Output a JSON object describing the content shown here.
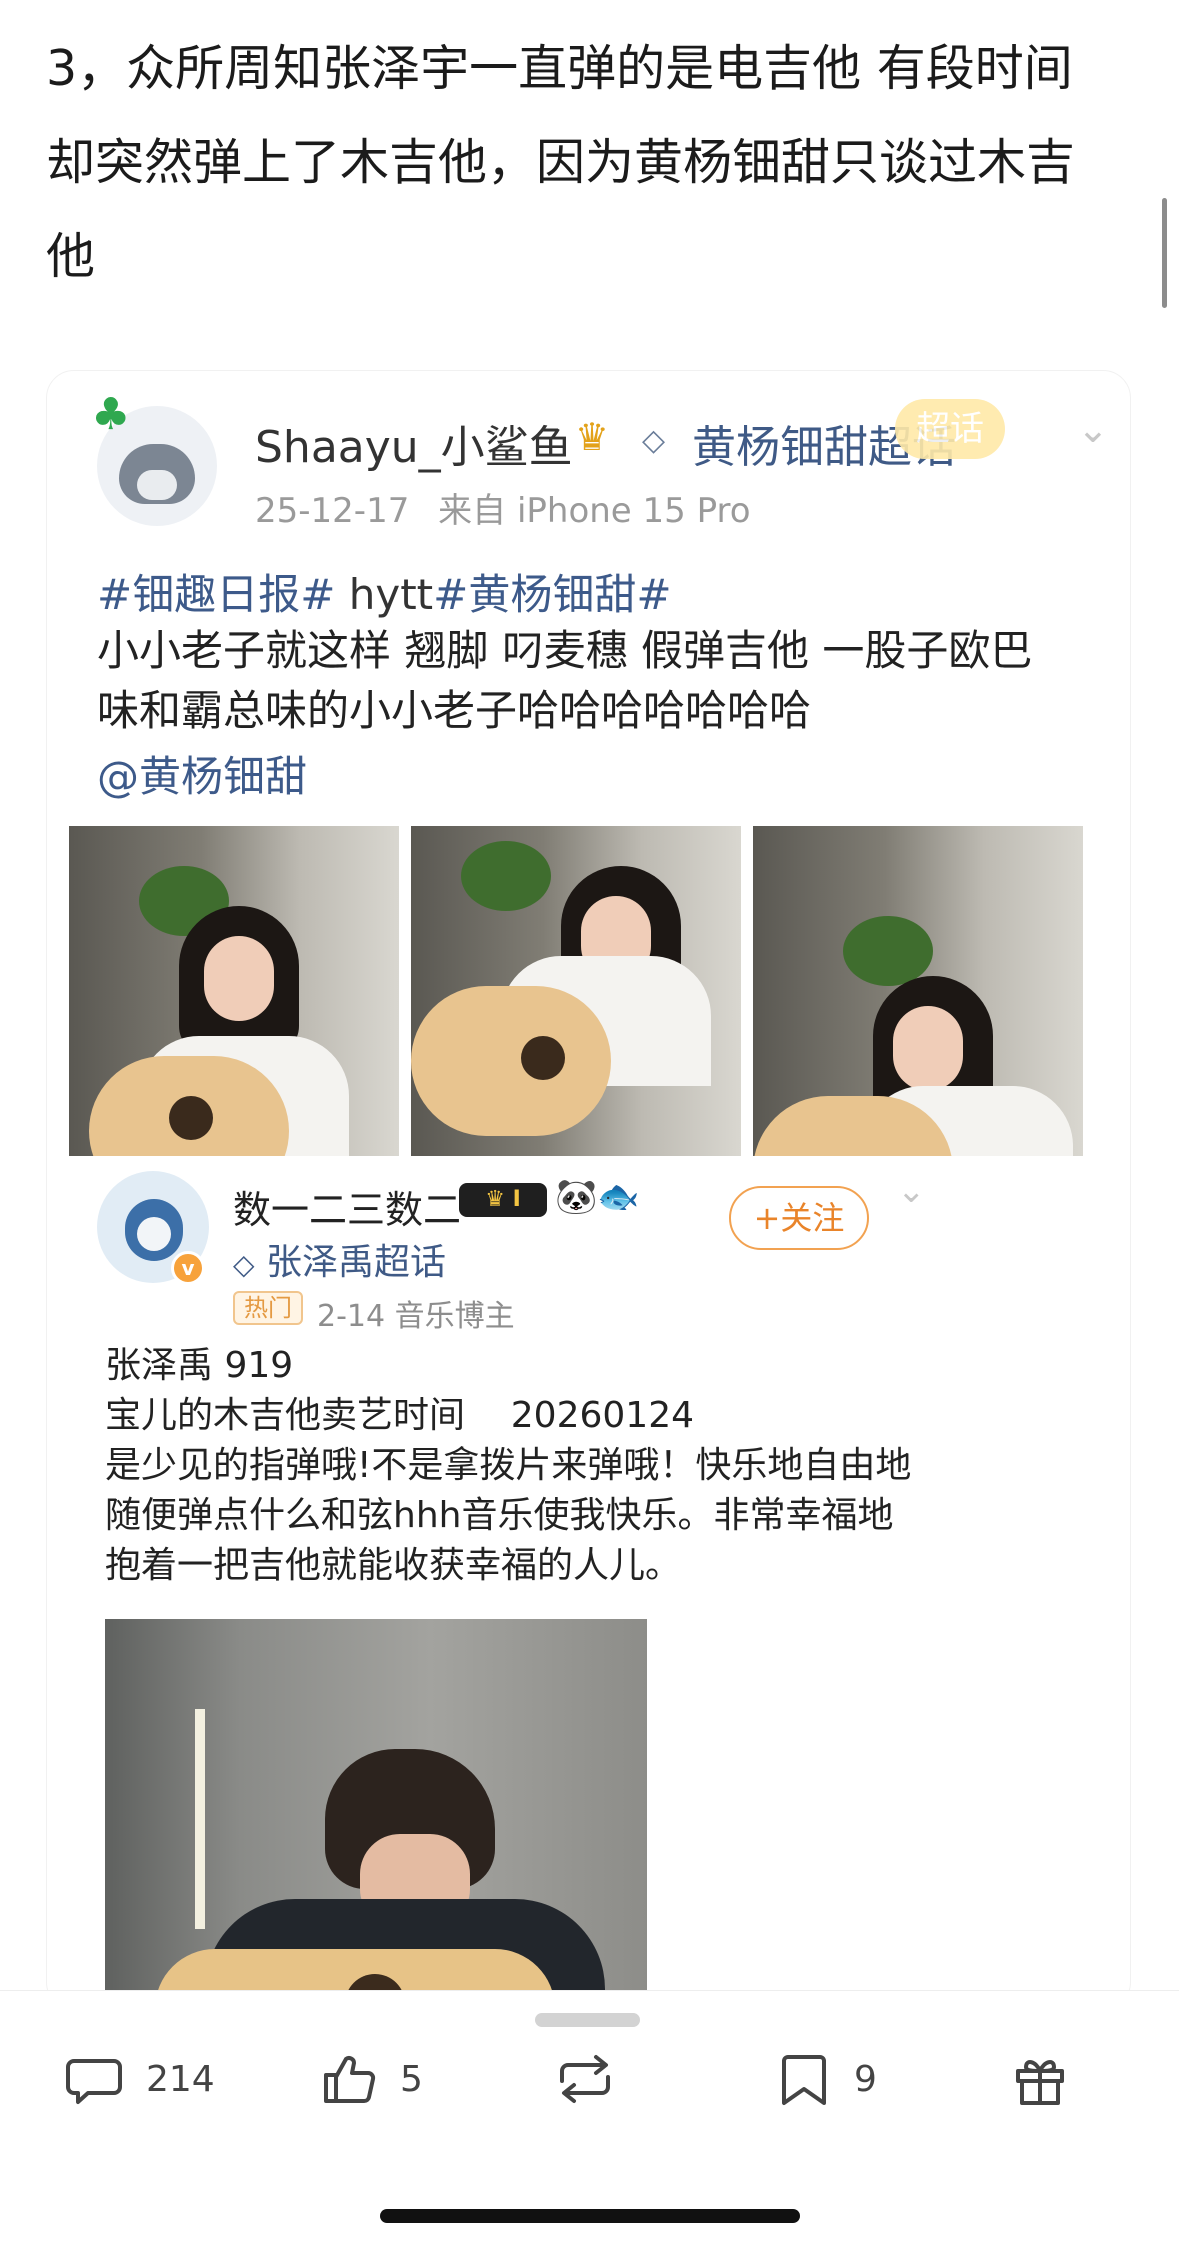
{
  "article": {
    "lines": [
      "3，众所周知张泽宇一直弹的是电吉他 有段时间",
      "却突然弹上了木吉他，因为黄杨钿甜只谈过木吉",
      "他"
    ]
  },
  "post1": {
    "username": "Shaayu_小鲨鱼",
    "topic": "黄杨钿甜超话",
    "badge": "超话",
    "date": "25-12-17",
    "source": "来自 iPhone 15 Pro",
    "tags": {
      "tag1": "#钿趣日报#",
      "plain": " hytt",
      "tag2": "#黄杨钿甜#"
    },
    "body_lines": [
      "小小老子就这样 翘脚 叼麦穗 假弹吉他 一股子欧巴",
      "味和霸总味的小小老子哈哈哈哈哈哈哈"
    ],
    "mention": "@黄杨钿甜"
  },
  "post2": {
    "username": "数一二三数二",
    "vip": "I",
    "topic": "张泽禹超话",
    "follow": "+关注",
    "hot": "热门",
    "meta": "2-14  音乐博主",
    "body_lines": [
      "张泽禹 919",
      "宝儿的木吉他卖艺时间    20260124",
      "是少见的指弹哦!不是拿拨片来弹哦！快乐地自由地",
      "随便弹点什么和弦hhh音乐使我快乐。非常幸福地",
      "抱着一把吉他就能收获幸福的人儿。"
    ]
  },
  "actions": {
    "comments": "214",
    "likes": "5",
    "favorites": "9"
  }
}
